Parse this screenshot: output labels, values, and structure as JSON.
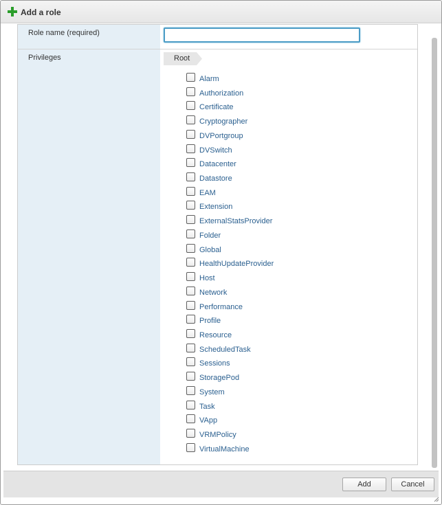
{
  "dialog": {
    "title": "Add a role",
    "icon": "green-plus-icon",
    "accent_color": "#2a9d2a"
  },
  "form": {
    "role_name_label": "Role name (required)",
    "role_name_value": "",
    "privileges_label": "Privileges",
    "breadcrumb": "Root",
    "privileges": [
      "Alarm",
      "Authorization",
      "Certificate",
      "Cryptographer",
      "DVPortgroup",
      "DVSwitch",
      "Datacenter",
      "Datastore",
      "EAM",
      "Extension",
      "ExternalStatsProvider",
      "Folder",
      "Global",
      "HealthUpdateProvider",
      "Host",
      "Network",
      "Performance",
      "Profile",
      "Resource",
      "ScheduledTask",
      "Sessions",
      "StoragePod",
      "System",
      "Task",
      "VApp",
      "VRMPolicy",
      "VirtualMachine"
    ]
  },
  "footer": {
    "add_label": "Add",
    "cancel_label": "Cancel"
  },
  "colors": {
    "link_text": "#2a5f8f",
    "label_column": "#e5eff6",
    "input_focus": "#4b9cc6"
  }
}
